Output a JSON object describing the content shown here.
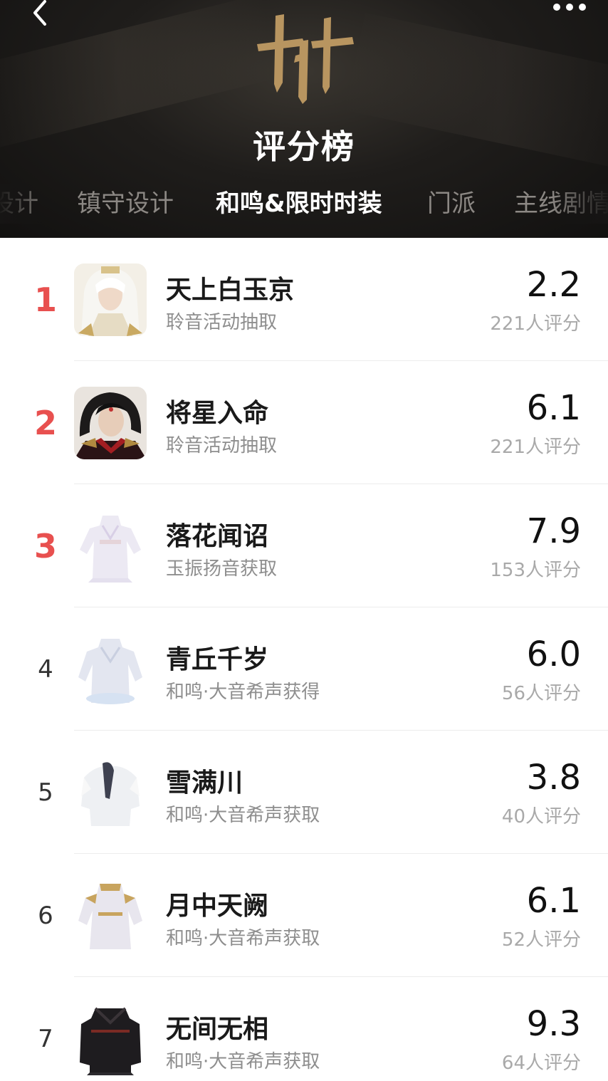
{
  "header": {
    "title": "评分榜",
    "colors": {
      "background": "#1b1a18",
      "logo": "#b89560",
      "active_tab": "#ffffff",
      "inactive_tab": "#8c8884"
    }
  },
  "tabs": [
    {
      "label": "设计"
    },
    {
      "label": "镇守设计"
    },
    {
      "label": "和鸣&限时时装",
      "active": true
    },
    {
      "label": "门派"
    },
    {
      "label": "主线剧情"
    }
  ],
  "ranking": [
    {
      "rank": "1",
      "name": "天上白玉京",
      "source": "聆音活动抽取",
      "score": "2.2",
      "count": "221人评分",
      "thumb": "portrait-white-hair"
    },
    {
      "rank": "2",
      "name": "将星入命",
      "source": "聆音活动抽取",
      "score": "6.1",
      "count": "221人评分",
      "thumb": "portrait-dark-hair"
    },
    {
      "rank": "3",
      "name": "落花闻诏",
      "source": "玉振扬音获取",
      "score": "7.9",
      "count": "153人评分",
      "thumb": "outfit-lavender"
    },
    {
      "rank": "4",
      "name": "青丘千岁",
      "source": "和鸣·大音希声获得",
      "score": "6.0",
      "count": "56人评分",
      "thumb": "outfit-pale-blue"
    },
    {
      "rank": "5",
      "name": "雪满川",
      "source": "和鸣·大音希声获取",
      "score": "3.8",
      "count": "40人评分",
      "thumb": "outfit-white-fur"
    },
    {
      "rank": "6",
      "name": "月中天阙",
      "source": "和鸣·大音希声获取",
      "score": "6.1",
      "count": "52人评分",
      "thumb": "outfit-white-gold"
    },
    {
      "rank": "7",
      "name": "无间无相",
      "source": "和鸣·大音希声获取",
      "score": "9.3",
      "count": "64人评分",
      "thumb": "outfit-black-red"
    }
  ],
  "accent": {
    "top_rank": "#e8504f"
  }
}
